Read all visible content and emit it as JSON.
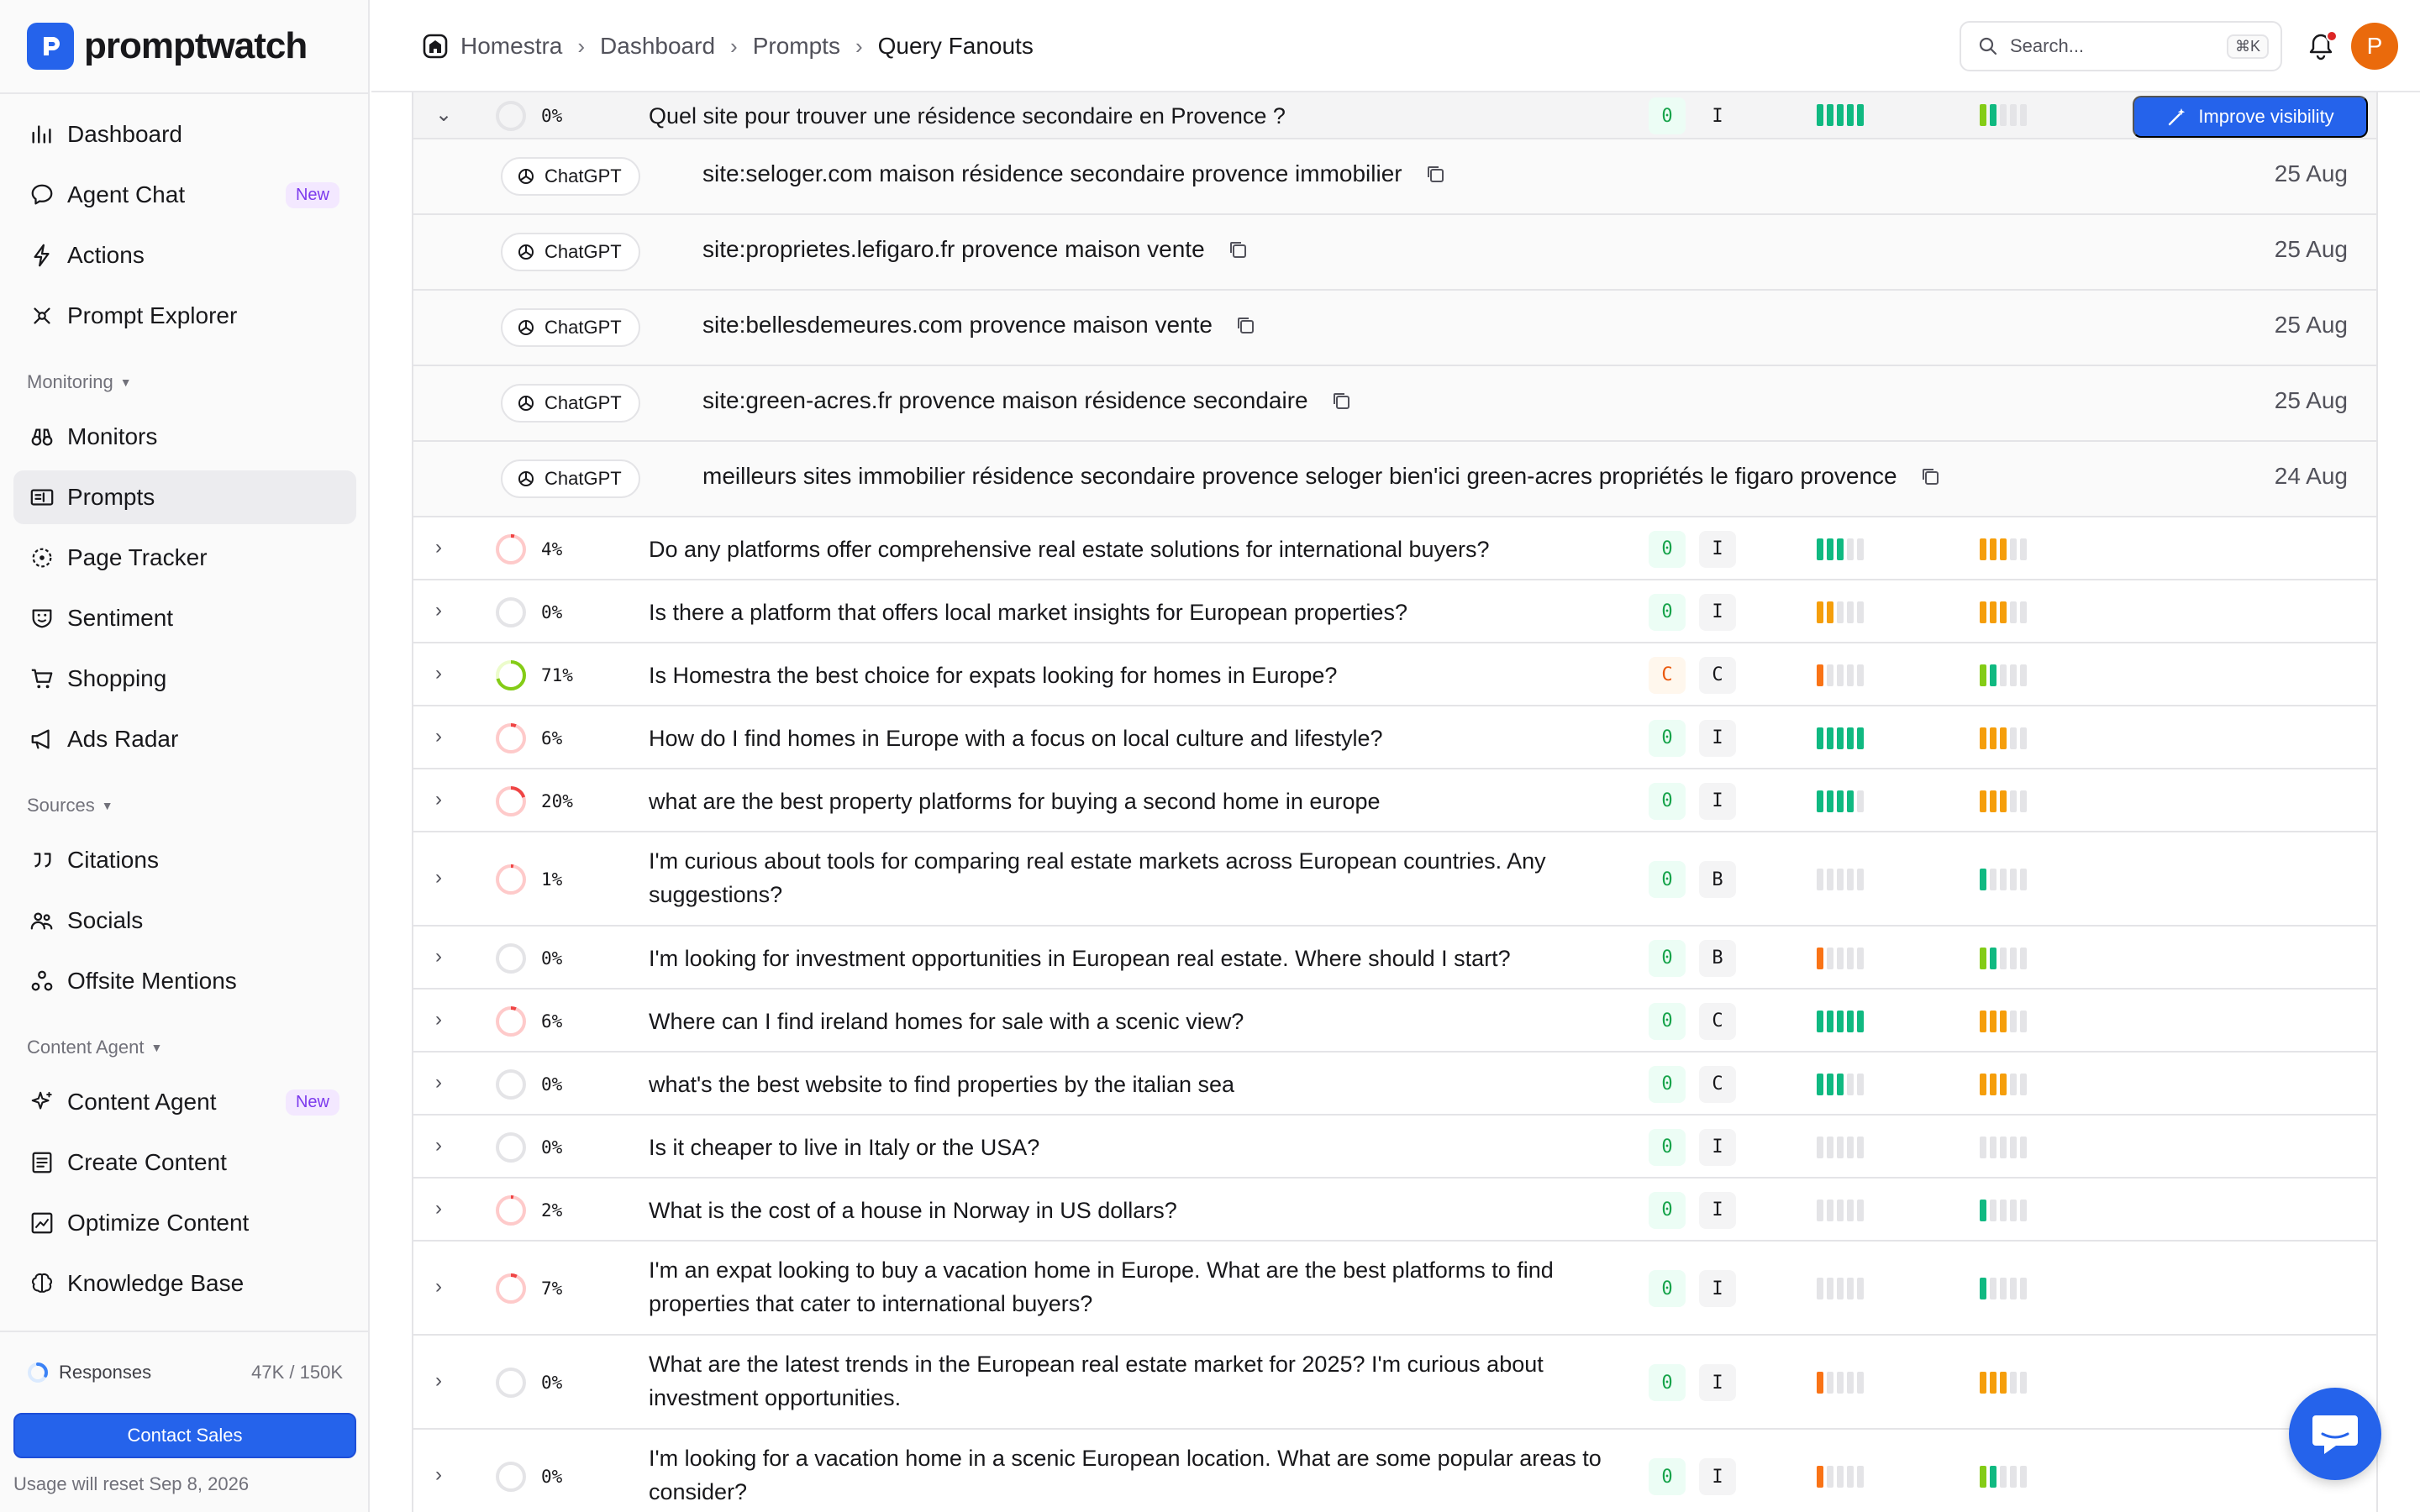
{
  "app": {
    "name": "promptwatch"
  },
  "sidebar": {
    "items_top": [
      {
        "label": "Dashboard",
        "icon": "bar-chart-icon"
      },
      {
        "label": "Agent Chat",
        "icon": "chat-icon",
        "badge": "New"
      },
      {
        "label": "Actions",
        "icon": "bolt-icon"
      },
      {
        "label": "Prompt Explorer",
        "icon": "explorer-icon"
      }
    ],
    "monitoring_label": "Monitoring",
    "items_monitoring": [
      {
        "label": "Monitors",
        "icon": "binoculars-icon"
      },
      {
        "label": "Prompts",
        "icon": "prompts-icon",
        "active": true
      },
      {
        "label": "Page Tracker",
        "icon": "page-tracker-icon"
      },
      {
        "label": "Sentiment",
        "icon": "sentiment-icon"
      },
      {
        "label": "Shopping",
        "icon": "cart-icon"
      },
      {
        "label": "Ads Radar",
        "icon": "megaphone-icon"
      }
    ],
    "sources_label": "Sources",
    "items_sources": [
      {
        "label": "Citations",
        "icon": "quote-icon"
      },
      {
        "label": "Socials",
        "icon": "people-icon"
      },
      {
        "label": "Offsite Mentions",
        "icon": "share-icon"
      }
    ],
    "content_label": "Content Agent",
    "items_content": [
      {
        "label": "Content Agent",
        "icon": "sparkle-icon",
        "badge": "New"
      },
      {
        "label": "Create Content",
        "icon": "document-icon"
      },
      {
        "label": "Optimize Content",
        "icon": "chart-doc-icon"
      },
      {
        "label": "Knowledge Base",
        "icon": "brain-icon"
      }
    ],
    "usage": {
      "label": "Responses",
      "value": "47K / 150K",
      "fraction": 0.31
    },
    "contact_sales": "Contact Sales",
    "usage_reset": "Usage will reset Sep 8, 2026"
  },
  "header": {
    "breadcrumb": [
      "Homestra",
      "Dashboard",
      "Prompts",
      "Query Fanouts"
    ],
    "search_placeholder": "Search...",
    "search_shortcut": "⌘K",
    "avatar_initial": "P"
  },
  "expanded": {
    "percent": "0%",
    "text": "Quel site pour trouver une résidence secondaire en Provence ?",
    "chip1": "0",
    "chip2": "I",
    "bars1": {
      "filled": 5,
      "color": "#10b981"
    },
    "bars2": {
      "filled": 2,
      "colors": [
        "#84cc16",
        "#10b981"
      ]
    },
    "improve_label": "Improve visibility",
    "fanouts": [
      {
        "model": "ChatGPT",
        "query": "site:seloger.com maison résidence secondaire provence immobilier",
        "date": "25 Aug"
      },
      {
        "model": "ChatGPT",
        "query": "site:proprietes.lefigaro.fr provence maison vente",
        "date": "25 Aug"
      },
      {
        "model": "ChatGPT",
        "query": "site:bellesdemeures.com provence maison vente",
        "date": "25 Aug"
      },
      {
        "model": "ChatGPT",
        "query": "site:green-acres.fr provence maison résidence secondaire",
        "date": "25 Aug"
      },
      {
        "model": "ChatGPT",
        "query": "meilleurs sites immobilier résidence secondaire provence seloger bien'ici green-acres propriétés le figaro provence",
        "date": "24 Aug"
      }
    ]
  },
  "rows": [
    {
      "percent": "4%",
      "ring": 0.04,
      "text": "Do any platforms offer comprehensive real estate solutions for international buyers?",
      "chip1": "0",
      "chip1_color": "green",
      "chip2": "I",
      "bars1": [
        3,
        "#10b981"
      ],
      "bars2": [
        3,
        "#f59e0b"
      ]
    },
    {
      "percent": "0%",
      "ring": 0,
      "text": "Is there a platform that offers local market insights for European properties?",
      "chip1": "0",
      "chip1_color": "green",
      "chip2": "I",
      "bars1": [
        2,
        "#f59e0b"
      ],
      "bars2": [
        3,
        "#f59e0b"
      ]
    },
    {
      "percent": "71%",
      "ring": 0.71,
      "text": "Is Homestra the best choice for expats looking for homes in Europe?",
      "chip1": "C",
      "chip1_color": "orange",
      "chip2": "C",
      "bars1": [
        1,
        "#f97316"
      ],
      "bars2": [
        2,
        "#84cc16"
      ]
    },
    {
      "percent": "6%",
      "ring": 0.06,
      "text": "How do I find homes in Europe with a focus on local culture and lifestyle?",
      "chip1": "0",
      "chip1_color": "green",
      "chip2": "I",
      "bars1": [
        5,
        "#10b981"
      ],
      "bars2": [
        3,
        "#f59e0b"
      ]
    },
    {
      "percent": "20%",
      "ring": 0.2,
      "text": "what are the best property platforms for buying a second home in europe",
      "chip1": "0",
      "chip1_color": "green",
      "chip2": "I",
      "bars1": [
        4,
        "#10b981"
      ],
      "bars2": [
        3,
        "#f59e0b"
      ]
    },
    {
      "percent": "1%",
      "ring": 0.01,
      "text": "I'm curious about tools for comparing real estate markets across European countries. Any suggestions?",
      "chip1": "0",
      "chip1_color": "green",
      "chip2": "B",
      "bars1": [
        0,
        "#e4e4e7"
      ],
      "bars2": [
        1,
        "#10b981"
      ],
      "tall": true
    },
    {
      "percent": "0%",
      "ring": 0,
      "text": "I'm looking for investment opportunities in European real estate. Where should I start?",
      "chip1": "0",
      "chip1_color": "green",
      "chip2": "B",
      "bars1": [
        1,
        "#f97316"
      ],
      "bars2": [
        2,
        "#84cc16"
      ]
    },
    {
      "percent": "6%",
      "ring": 0.06,
      "text": "Where can I find ireland homes for sale with a scenic view?",
      "chip1": "0",
      "chip1_color": "green",
      "chip2": "C",
      "bars1": [
        5,
        "#10b981"
      ],
      "bars2": [
        3,
        "#f59e0b"
      ]
    },
    {
      "percent": "0%",
      "ring": 0,
      "text": "what's the best website to find properties by the italian sea",
      "chip1": "0",
      "chip1_color": "green",
      "chip2": "C",
      "bars1": [
        3,
        "#10b981"
      ],
      "bars2": [
        3,
        "#f59e0b"
      ]
    },
    {
      "percent": "0%",
      "ring": 0,
      "text": "Is it cheaper to live in Italy or the USA?",
      "chip1": "0",
      "chip1_color": "green",
      "chip2": "I",
      "bars1": [
        0,
        "#e4e4e7"
      ],
      "bars2": [
        0,
        "#e4e4e7"
      ]
    },
    {
      "percent": "2%",
      "ring": 0.02,
      "text": "What is the cost of a house in Norway in US dollars?",
      "chip1": "0",
      "chip1_color": "green",
      "chip2": "I",
      "bars1": [
        0,
        "#e4e4e7"
      ],
      "bars2": [
        1,
        "#10b981"
      ]
    },
    {
      "percent": "7%",
      "ring": 0.07,
      "text": "I'm an expat looking to buy a vacation home in Europe. What are the best platforms to find properties that cater to international buyers?",
      "chip1": "0",
      "chip1_color": "green",
      "chip2": "I",
      "bars1": [
        0,
        "#e4e4e7"
      ],
      "bars2": [
        1,
        "#10b981"
      ],
      "tall": true
    },
    {
      "percent": "0%",
      "ring": 0,
      "text": "What are the latest trends in the European real estate market for 2025? I'm curious about investment opportunities.",
      "chip1": "0",
      "chip1_color": "green",
      "chip2": "I",
      "bars1": [
        1,
        "#f97316"
      ],
      "bars2": [
        3,
        "#f59e0b"
      ],
      "tall": true
    },
    {
      "percent": "0%",
      "ring": 0,
      "text": "I'm looking for a vacation home in a scenic European location. What are some popular areas to consider?",
      "chip1": "0",
      "chip1_color": "green",
      "chip2": "I",
      "bars1": [
        1,
        "#f97316"
      ],
      "bars2": [
        2,
        "#84cc16"
      ],
      "tall": true
    }
  ],
  "colors": {
    "accent": "#2563eb",
    "ring_track": "#fecaca",
    "ring_red": "#ef4444",
    "ring_green": "#84cc16"
  }
}
